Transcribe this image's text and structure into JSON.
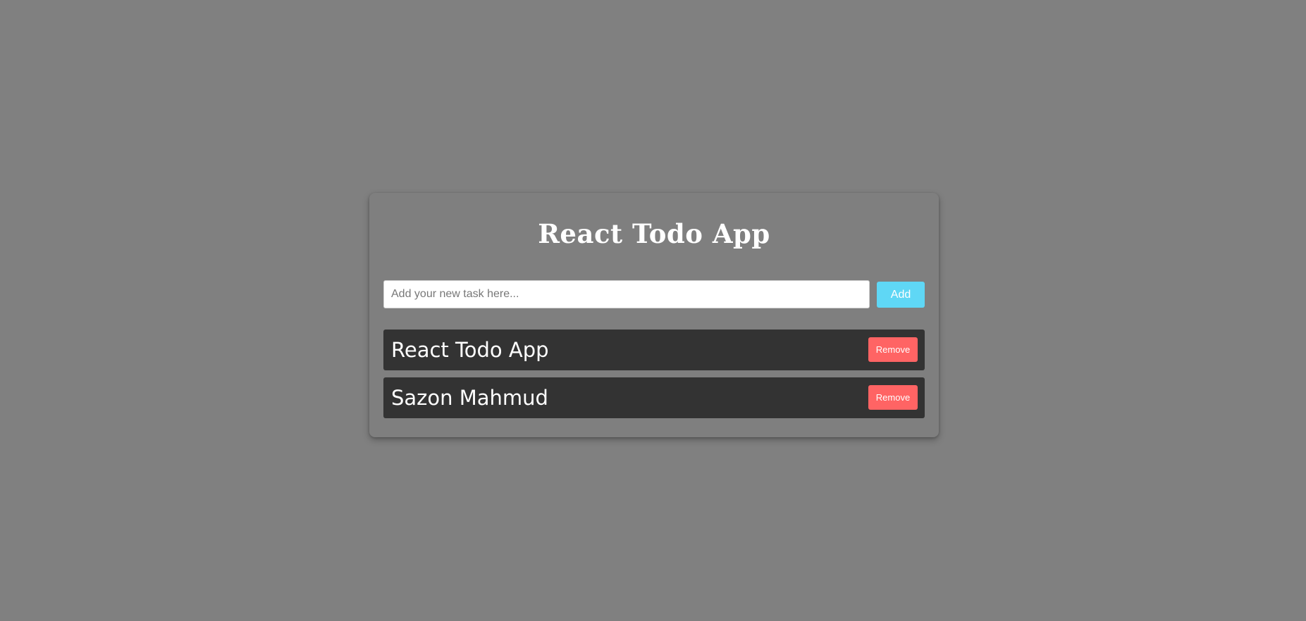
{
  "app": {
    "title": "React Todo App"
  },
  "input": {
    "value": "",
    "placeholder": "Add your new task here..."
  },
  "add_button": {
    "label": "Add"
  },
  "todos": [
    {
      "text": "React Todo App",
      "remove_label": "Remove"
    },
    {
      "text": "Sazon Mahmud",
      "remove_label": "Remove"
    }
  ],
  "colors": {
    "page_background": "#808080",
    "card_background": "#7f7f7f",
    "item_background": "#333333",
    "add_button": "#5fd7f5",
    "remove_button": "#ff6464",
    "text": "#ffffff"
  }
}
